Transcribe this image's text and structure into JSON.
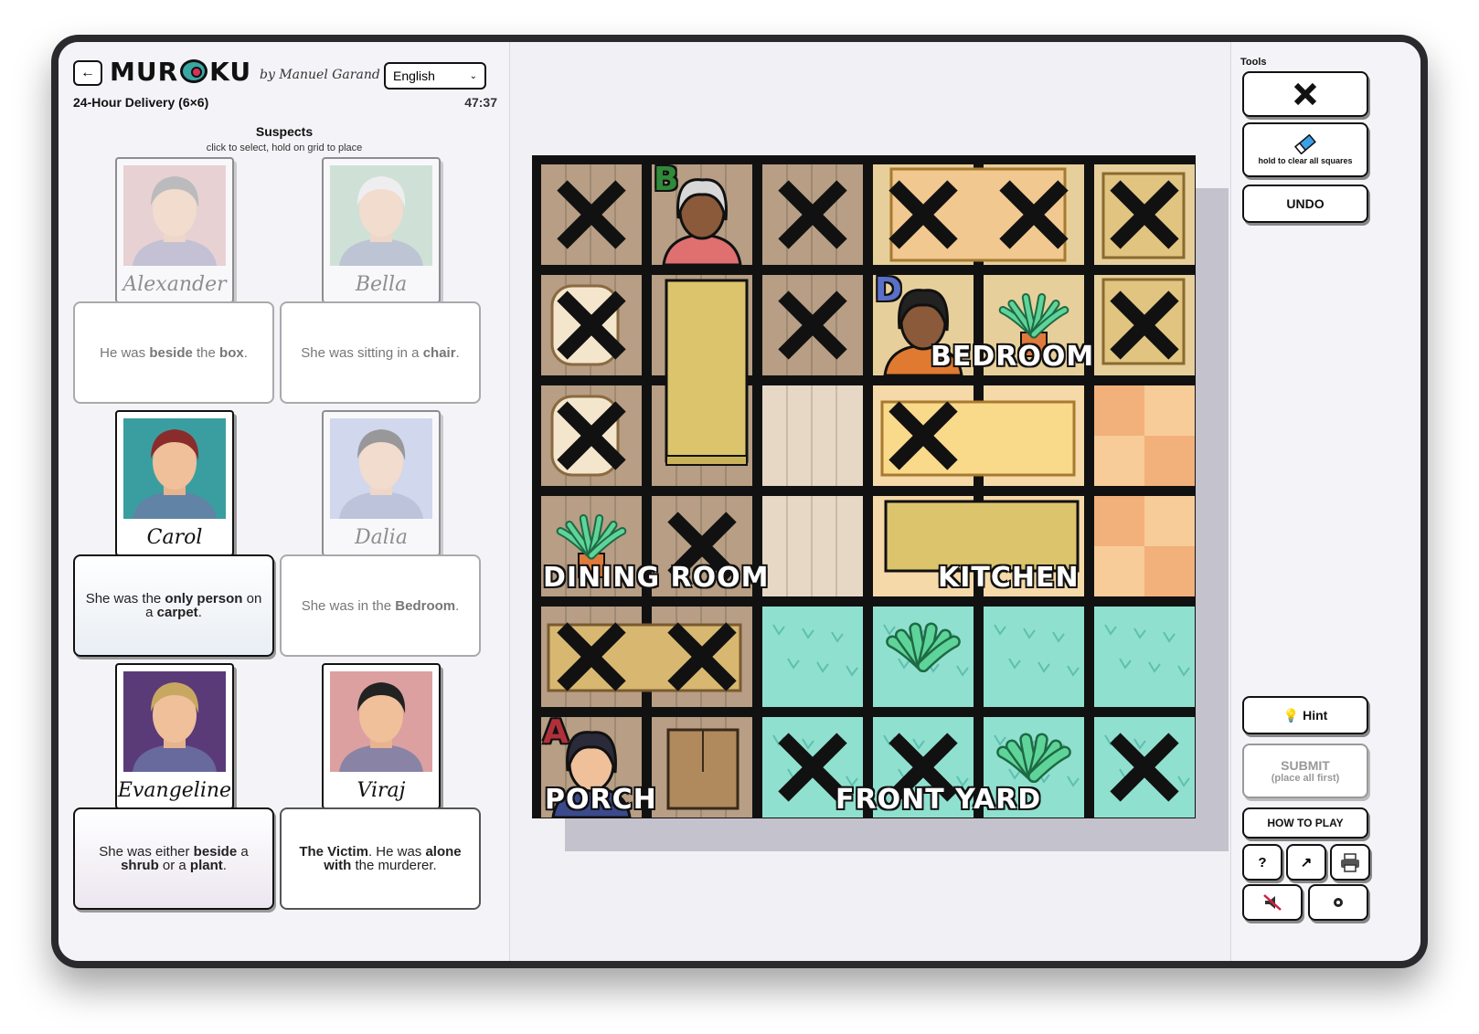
{
  "header": {
    "back_icon": "arrow-left-icon",
    "logo_text_left": "MUR",
    "logo_text_right": "KU",
    "byline": "by Manuel Garand",
    "language": "English",
    "puzzle_title": "24-Hour Delivery (6×6)",
    "timer": "47:37"
  },
  "suspects": {
    "heading": "Suspects",
    "subheading": "click to select, hold on grid to place",
    "list": [
      {
        "name": "Alexander",
        "clue_html": "He was <b>beside</b> the <b>box</b>.",
        "placed": true,
        "bg": "#d9a8a8",
        "hair": "#777777"
      },
      {
        "name": "Bella",
        "clue_html": "She was sitting in a <b>chair</b>.",
        "placed": true,
        "bg": "#a3cbb0",
        "hair": "#e8e8e8"
      },
      {
        "name": "Carol",
        "clue_html": "She was the <b>only person</b> on a <b>carpet</b>.",
        "placed": false,
        "bg": "#3a9ea0",
        "hair": "#8a2c2c"
      },
      {
        "name": "Dalia",
        "clue_html": "She was in the <b>Bedroom</b>.",
        "placed": true,
        "bg": "#a7b4df",
        "hair": "#2a2a2a"
      },
      {
        "name": "Evangeline",
        "clue_html": "She was either <b>beside</b> a <b>shrub</b> or a <b>plant</b>.",
        "placed": false,
        "bg": "#5a3b78",
        "hair": "#c8a860"
      },
      {
        "name": "Viraj",
        "clue_html": "<b>The Victim</b>. He was <b>alone with</b> the murderer.",
        "placed": false,
        "bg": "#dca0a0",
        "hair": "#222222"
      }
    ]
  },
  "board": {
    "rooms": [
      "DINING ROOM",
      "BEDROOM",
      "KITCHEN",
      "PORCH",
      "FRONT YARD"
    ],
    "markers": {
      "A": "#b0303a",
      "B": "#2f8a3a",
      "D": "#5a6fc8"
    },
    "x_cells": [
      [
        0,
        0
      ],
      [
        0,
        2
      ],
      [
        0,
        3
      ],
      [
        0,
        4
      ],
      [
        0,
        5
      ],
      [
        1,
        0
      ],
      [
        1,
        2
      ],
      [
        1,
        5
      ],
      [
        2,
        0
      ],
      [
        2,
        3
      ],
      [
        3,
        1
      ],
      [
        4,
        0
      ],
      [
        4,
        1
      ],
      [
        5,
        2
      ],
      [
        5,
        3
      ],
      [
        5,
        5
      ]
    ]
  },
  "tools": {
    "heading": "Tools",
    "x_icon": "x-mark-icon",
    "eraser_label": "hold to clear all squares",
    "undo_label": "UNDO",
    "hint_label": "Hint",
    "hint_icon": "lightbulb-icon",
    "submit_label": "SUBMIT",
    "submit_sub": "(place all first)",
    "how_to_play": "HOW TO PLAY",
    "help_glyph": "?",
    "share_glyph": "↗"
  }
}
